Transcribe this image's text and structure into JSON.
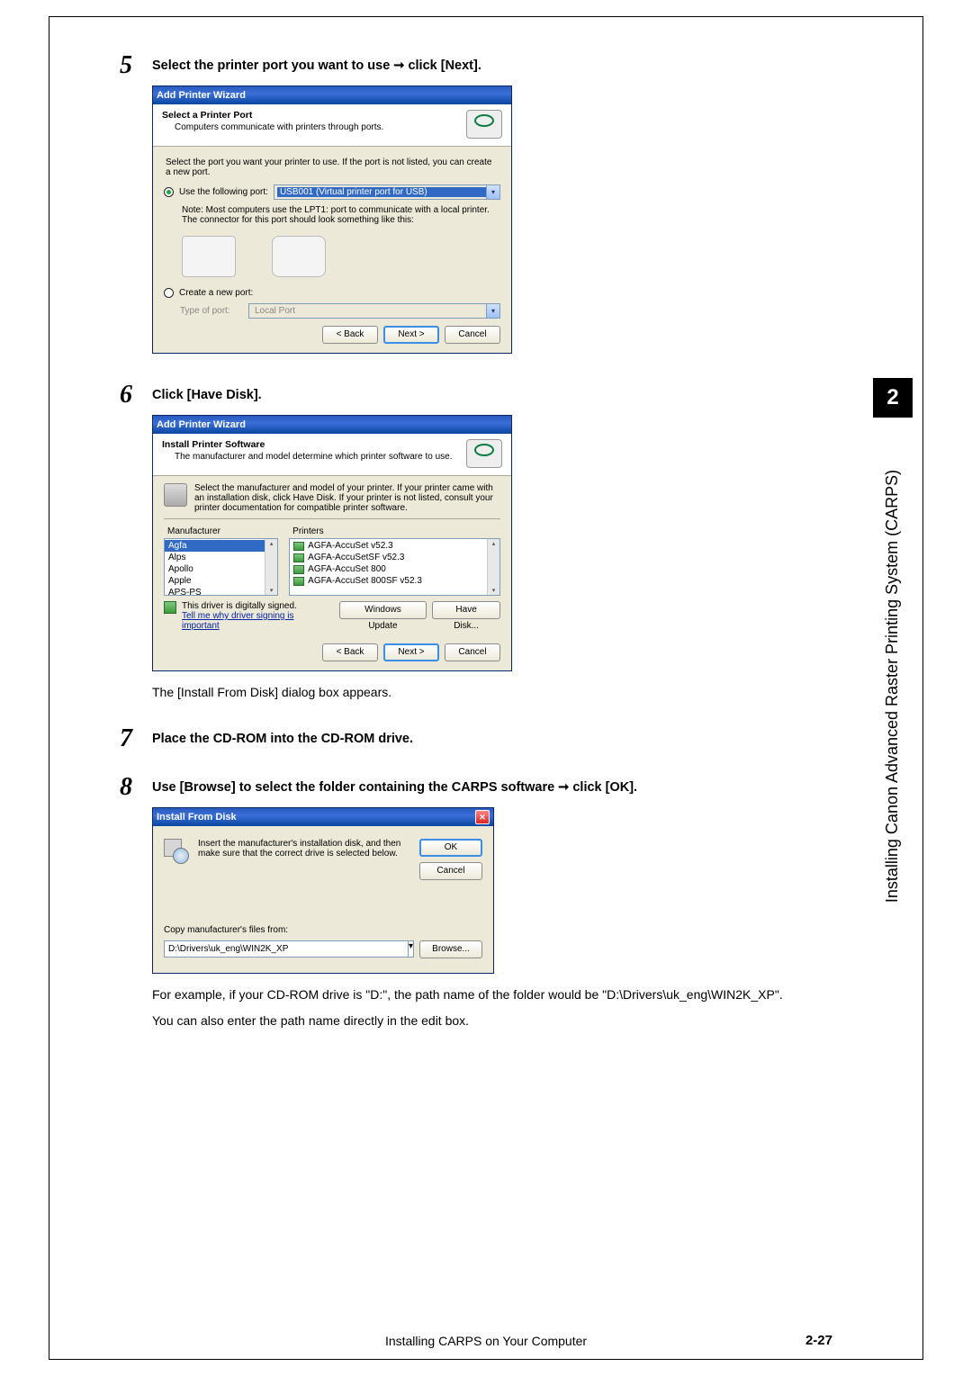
{
  "steps": {
    "s5": {
      "num": "5",
      "title": "Select the printer port you want to use ➞ click [Next]."
    },
    "s6": {
      "num": "6",
      "title": "Click [Have Disk].",
      "after": "The [Install From Disk] dialog box appears."
    },
    "s7": {
      "num": "7",
      "title": "Place the CD-ROM into the CD-ROM drive."
    },
    "s8": {
      "num": "8",
      "title": "Use [Browse] to select the folder containing the CARPS software ➞ click [OK].",
      "after1": "For example, if your CD-ROM drive is \"D:\", the path name of the folder would be \"D:\\Drivers\\uk_eng\\WIN2K_XP\".",
      "after2": "You can also enter the path name directly in the edit box."
    }
  },
  "dialog5": {
    "caption": "Add Printer Wizard",
    "headTitle": "Select a Printer Port",
    "headSub": "Computers communicate with printers through ports.",
    "intro": "Select the port you want your printer to use. If the port is not listed, you can create a new port.",
    "radio1": "Use the following port:",
    "portValue": "USB001 (Virtual printer port for USB)",
    "note1": "Note: Most computers use the LPT1: port to communicate with a local printer.",
    "note2": "The connector for this port should look something like this:",
    "radio2": "Create a new port:",
    "typeLabel": "Type of port:",
    "typeValue": "Local Port",
    "back": "< Back",
    "next": "Next >",
    "cancel": "Cancel"
  },
  "dialog6": {
    "caption": "Add Printer Wizard",
    "headTitle": "Install Printer Software",
    "headSub": "The manufacturer and model determine which printer software to use.",
    "intro": "Select the manufacturer and model of your printer. If your printer came with an installation disk, click Have Disk. If your printer is not listed, consult your printer documentation for compatible printer software.",
    "mfrLabel": "Manufacturer",
    "prnLabel": "Printers",
    "mfrs": [
      "Agfa",
      "Alps",
      "Apollo",
      "Apple",
      "APS-PS"
    ],
    "printers": [
      "AGFA-AccuSet v52.3",
      "AGFA-AccuSetSF v52.3",
      "AGFA-AccuSet 800",
      "AGFA-AccuSet 800SF v52.3"
    ],
    "signed": "This driver is digitally signed.",
    "signedLink": "Tell me why driver signing is important",
    "winUpdate": "Windows Update",
    "haveDisk": "Have Disk...",
    "back": "< Back",
    "next": "Next >",
    "cancel": "Cancel"
  },
  "dialog8": {
    "caption": "Install From Disk",
    "msg": "Insert the manufacturer's installation disk, and then make sure that the correct drive is selected below.",
    "ok": "OK",
    "cancel": "Cancel",
    "copyLabel": "Copy manufacturer's files from:",
    "path": "D:\\Drivers\\uk_eng\\WIN2K_XP",
    "browse": "Browse..."
  },
  "sidebar": {
    "chapterNum": "2",
    "chapterTitle": "Installing Canon Advanced Raster Printing System (CARPS)"
  },
  "footer": {
    "text": "Installing CARPS on Your Computer",
    "page": "2-27"
  }
}
